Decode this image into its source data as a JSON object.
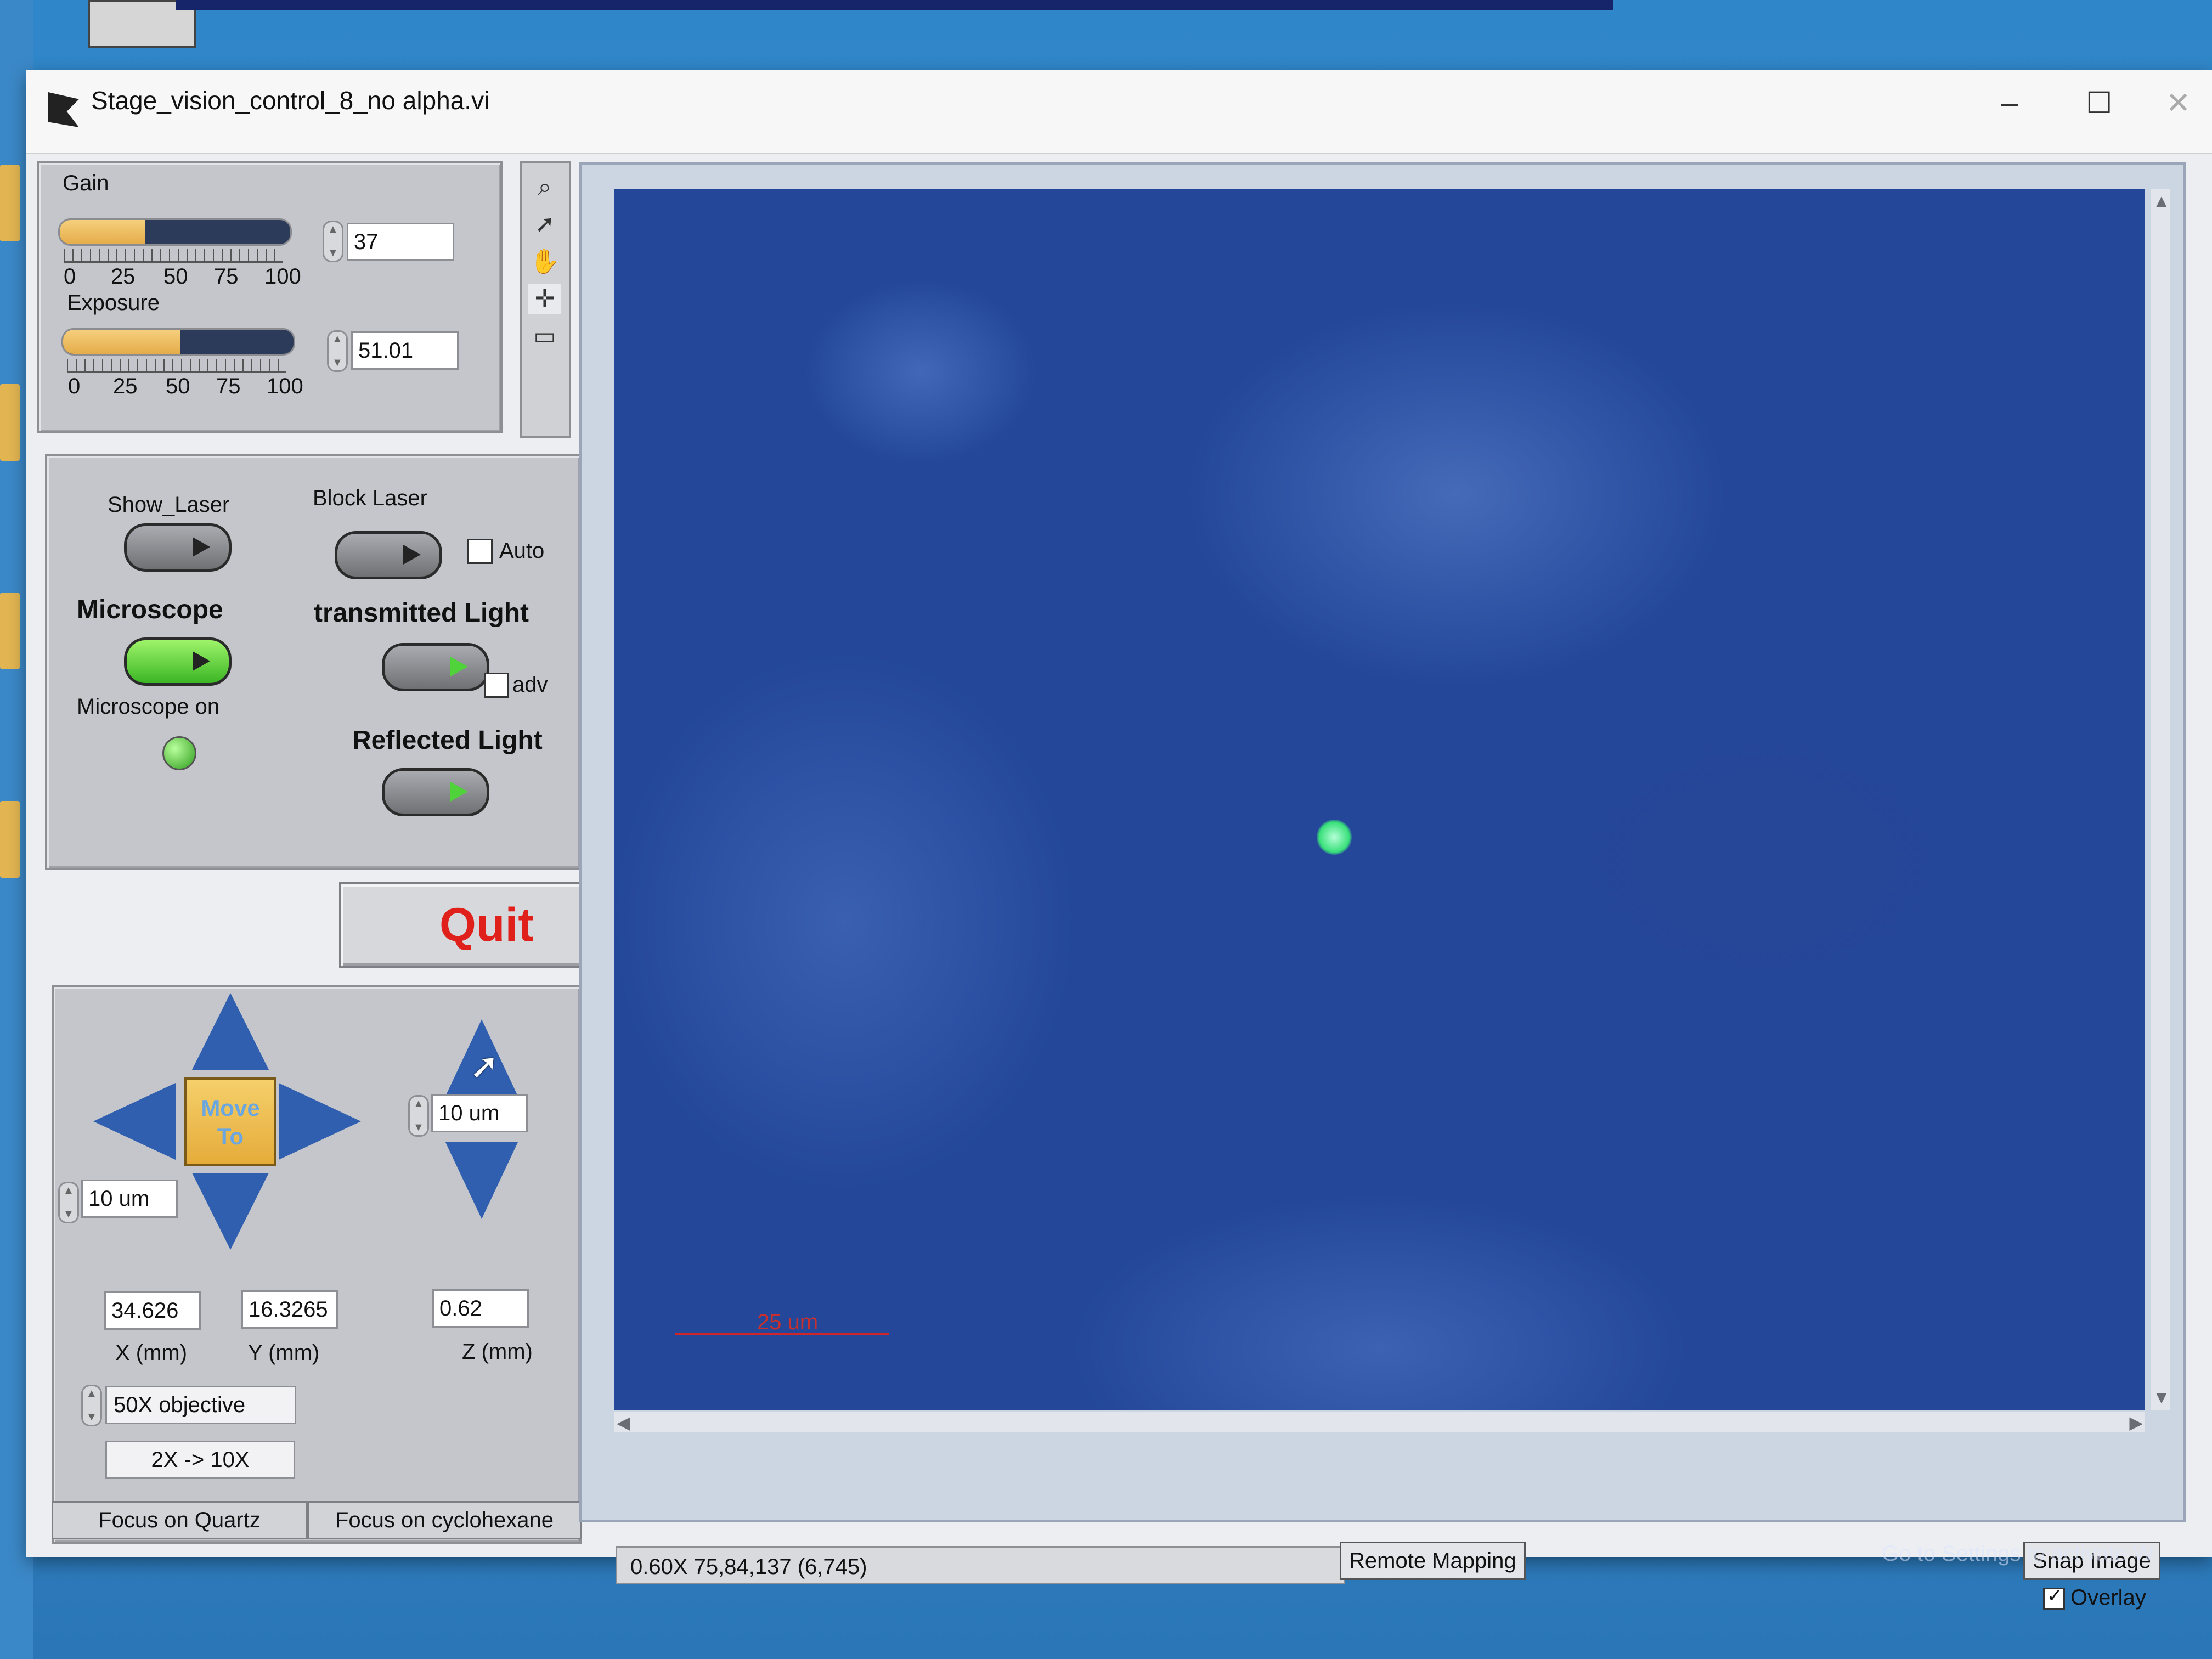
{
  "window": {
    "title": "Stage_vision_control_8_no alpha.vi",
    "controls": {
      "minimize": "–",
      "maximize": "☐",
      "close": "✕"
    }
  },
  "camera": {
    "gain": {
      "label": "Gain",
      "value": "37",
      "level_percent": 37
    },
    "exposure": {
      "label": "Exposure",
      "value": "51.01",
      "level_percent": 51
    },
    "scale_ticks": [
      "0",
      "25",
      "50",
      "75",
      "100"
    ]
  },
  "light_controls": {
    "show_laser": "Show_Laser",
    "block_laser": "Block Laser",
    "auto_label": "Auto",
    "microscope": "Microscope",
    "transmitted_light": "transmitted Light",
    "adv_label": "adv",
    "microscope_on": "Microscope on",
    "reflected_light": "Reflected Light"
  },
  "quit_label": "Quit",
  "stage": {
    "move_to_label": [
      "Move",
      "To"
    ],
    "xy_step": "10 um",
    "z_step": "10 um",
    "x_value": "34.626",
    "y_value": "16.3265",
    "z_value": "0.62",
    "x_label": "X (mm)",
    "y_label": "Y (mm)",
    "z_label": "Z (mm)",
    "objective": "50X objective",
    "objective_button": "2X -> 10X",
    "focus_quartz": "Focus on Quartz",
    "focus_cyclohexane": "Focus on cyclohexane"
  },
  "image": {
    "scale_bar_label": "25 um"
  },
  "statusbar": {
    "readout": "0.60X 75,84,137    (6,745)",
    "remote_mapping": "Remote Mapping",
    "snap_image": "Snap Image",
    "overlay": "Overlay"
  },
  "os_watermark": "Go to Settings to activate W",
  "icons": [
    "zoom-icon",
    "pointer-icon",
    "hand-icon",
    "crosshair-icon",
    "rectangle-icon"
  ],
  "colors": {
    "slider_fill": "#e5ad4a",
    "quit_text": "#e0201a",
    "image_bg": "#24479a",
    "arrow": "#2f5fae"
  }
}
